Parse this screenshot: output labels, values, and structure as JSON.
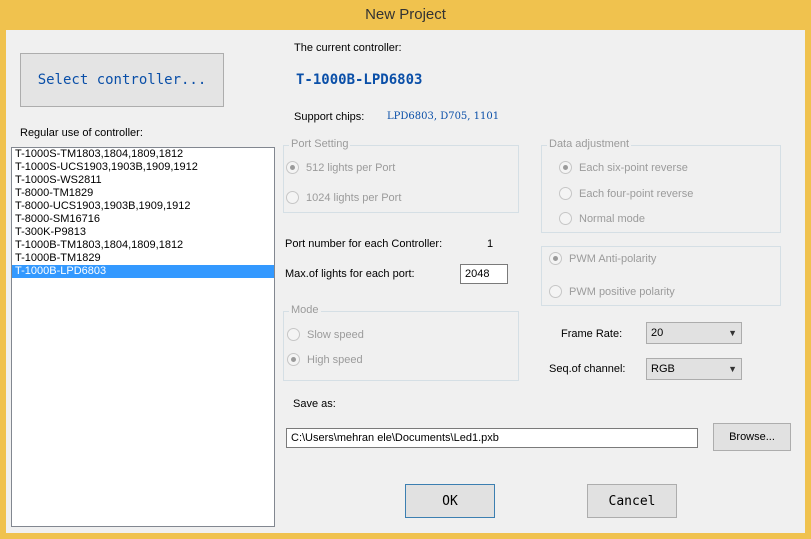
{
  "window": {
    "title": "New Project"
  },
  "select_controller_label": "Select controller...",
  "regular_use_label": "Regular use of controller:",
  "controllers": [
    "T-1000S-TM1803,1804,1809,1812",
    "T-1000S-UCS1903,1903B,1909,1912",
    "T-1000S-WS2811",
    "T-8000-TM1829",
    "T-8000-UCS1903,1903B,1909,1912",
    "T-8000-SM16716",
    "T-300K-P9813",
    "T-1000B-TM1803,1804,1809,1812",
    "T-1000B-TM1829",
    "T-1000B-LPD6803"
  ],
  "selected_controller": "T-1000B-LPD6803",
  "current_controller": {
    "label": "The current controller:",
    "value": "T-1000B-LPD6803"
  },
  "support_chips": {
    "label": "Support chips:",
    "value": "LPD6803, D705, 1101"
  },
  "port_setting": {
    "title": "Port Setting",
    "options": [
      "512 lights per Port",
      "1024 lights per Port"
    ],
    "selected": "512 lights per Port"
  },
  "data_adjustment": {
    "title": "Data adjustment",
    "options": [
      "Each six-point reverse",
      "Each four-point reverse",
      "Normal mode"
    ],
    "selected": "Each six-point reverse"
  },
  "pwm": {
    "options": [
      "PWM Anti-polarity",
      "PWM positive polarity"
    ],
    "selected": "PWM Anti-polarity"
  },
  "port_number": {
    "label": "Port number for each Controller:",
    "value": "1"
  },
  "max_lights": {
    "label": "Max.of lights for each port:",
    "value": "2048"
  },
  "mode": {
    "title": "Mode",
    "options": [
      "Slow speed",
      "High speed"
    ],
    "selected": "High speed"
  },
  "frame_rate": {
    "label": "Frame Rate:",
    "value": "20"
  },
  "seq_channel": {
    "label": "Seq.of channel:",
    "value": "RGB"
  },
  "save_as": {
    "label": "Save as:",
    "value": "C:\\Users\\mehran ele\\Documents\\Led1.pxb",
    "browse_label": "Browse..."
  },
  "ok_label": "OK",
  "cancel_label": "Cancel"
}
